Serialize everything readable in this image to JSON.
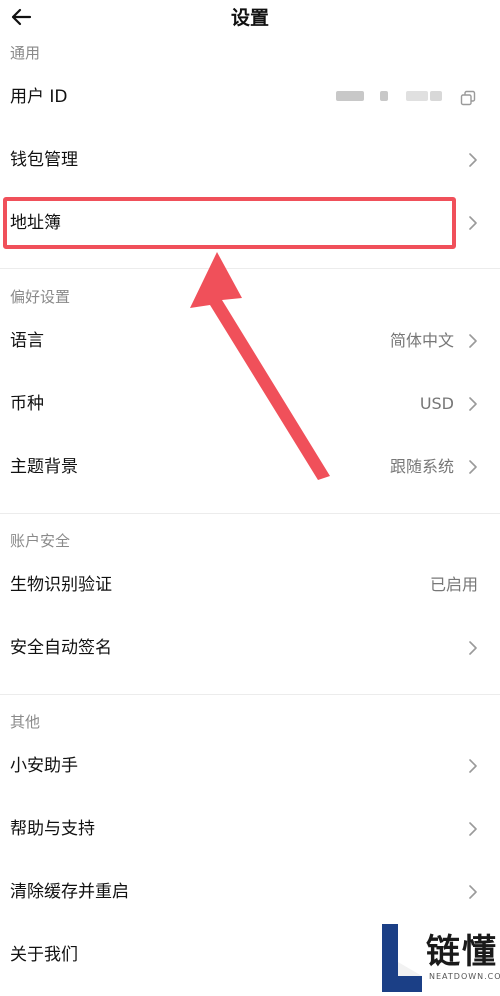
{
  "header": {
    "title": "设置",
    "back_icon": "arrow-left-icon"
  },
  "sections": {
    "general": {
      "title": "通用",
      "user_id_label": "用户 ID",
      "wallet_label": "钱包管理",
      "address_book_label": "地址簿"
    },
    "preferences": {
      "title": "偏好设置",
      "language_label": "语言",
      "language_value": "简体中文",
      "currency_label": "币种",
      "currency_value": "USD",
      "theme_label": "主题背景",
      "theme_value": "跟随系统"
    },
    "security": {
      "title": "账户安全",
      "biometric_label": "生物识别验证",
      "biometric_value": "已启用",
      "auto_sign_label": "安全自动签名"
    },
    "other": {
      "title": "其他",
      "assistant_label": "小安助手",
      "help_label": "帮助与支持",
      "clear_cache_label": "清除缓存并重启",
      "about_label": "关于我们"
    }
  },
  "annotation": {
    "color": "#f0505a"
  },
  "watermark": {
    "text": "链懂",
    "sub": "NEATDOWN.COM"
  }
}
